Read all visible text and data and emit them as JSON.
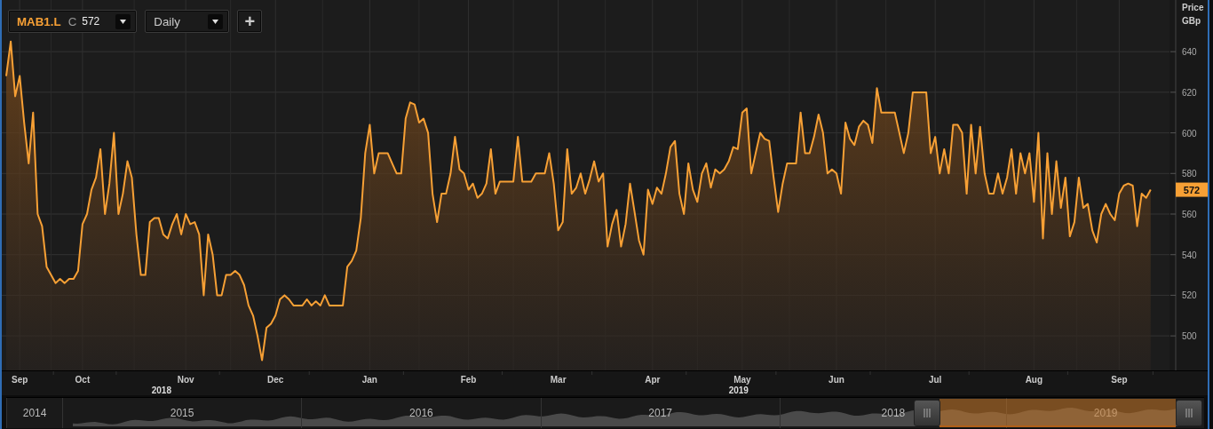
{
  "toolbar": {
    "symbol": "MAB1.L",
    "price_prefix": "C",
    "price": "572",
    "interval": "Daily",
    "add_button": "+"
  },
  "chart": {
    "axis_title": "Price",
    "axis_unit": "GBp",
    "last_price": "572",
    "year_labels": [
      "2018",
      "2019"
    ],
    "chart_data": {
      "type": "area",
      "grid": true,
      "categories": [
        null,
        null,
        null,
        "Sep",
        null,
        null,
        null,
        null,
        null,
        null,
        null,
        null,
        null,
        null,
        null,
        null,
        null,
        "Oct",
        null,
        null,
        null,
        null,
        null,
        null,
        null,
        null,
        null,
        null,
        null,
        null,
        null,
        null,
        null,
        null,
        null,
        null,
        null,
        null,
        null,
        null,
        "Nov",
        null,
        null,
        null,
        null,
        null,
        null,
        null,
        null,
        null,
        null,
        null,
        null,
        null,
        null,
        null,
        null,
        null,
        null,
        null,
        "Dec",
        null,
        null,
        null,
        null,
        null,
        null,
        null,
        null,
        null,
        null,
        null,
        null,
        null,
        null,
        null,
        null,
        null,
        null,
        null,
        null,
        "Jan",
        null,
        null,
        null,
        null,
        null,
        null,
        null,
        null,
        null,
        null,
        null,
        null,
        null,
        null,
        null,
        null,
        null,
        null,
        null,
        null,
        null,
        "Feb",
        null,
        null,
        null,
        null,
        null,
        null,
        null,
        null,
        null,
        null,
        null,
        null,
        null,
        null,
        null,
        null,
        null,
        null,
        null,
        "Mar",
        null,
        null,
        null,
        null,
        null,
        null,
        null,
        null,
        null,
        null,
        null,
        null,
        null,
        null,
        null,
        null,
        null,
        null,
        null,
        null,
        "Apr",
        null,
        null,
        null,
        null,
        null,
        null,
        null,
        null,
        null,
        null,
        null,
        null,
        null,
        null,
        null,
        null,
        null,
        null,
        null,
        "May",
        null,
        null,
        null,
        null,
        null,
        null,
        null,
        null,
        null,
        null,
        null,
        null,
        null,
        null,
        null,
        null,
        null,
        null,
        null,
        null,
        "Jun",
        null,
        null,
        null,
        null,
        null,
        null,
        null,
        null,
        null,
        null,
        null,
        null,
        null,
        null,
        null,
        null,
        null,
        null,
        null,
        null,
        null,
        "Jul",
        null,
        null,
        null,
        null,
        null,
        null,
        null,
        null,
        null,
        null,
        null,
        null,
        null,
        null,
        null,
        null,
        null,
        null,
        null,
        null,
        null,
        "Aug",
        null,
        null,
        null,
        null,
        null,
        null,
        null,
        null,
        null,
        null,
        null,
        null,
        null,
        null,
        null,
        null,
        null,
        null,
        "Sep",
        null,
        null,
        null,
        null,
        null,
        null,
        null
      ],
      "ylim": [
        483,
        665
      ],
      "yticks": [
        500,
        520,
        540,
        560,
        580,
        600,
        620,
        640
      ],
      "series": [
        {
          "color": "#f7a035",
          "values": [
            628,
            645,
            618,
            628,
            605,
            585,
            610,
            560,
            554,
            534,
            530,
            526,
            528,
            526,
            528,
            528,
            532,
            555,
            560,
            572,
            578,
            592,
            560,
            575,
            600,
            560,
            570,
            586,
            578,
            550,
            530,
            530,
            556,
            558,
            558,
            550,
            548,
            555,
            560,
            550,
            560,
            555,
            556,
            550,
            520,
            550,
            540,
            520,
            520,
            530,
            530,
            532,
            530,
            525,
            515,
            510,
            500,
            488,
            504,
            506,
            510,
            518,
            520,
            518,
            515,
            515,
            515,
            518,
            515,
            517,
            515,
            520,
            515,
            515,
            515,
            515,
            534,
            537,
            542,
            558,
            590,
            604,
            580,
            590,
            590,
            590,
            585,
            580,
            580,
            607,
            615,
            614,
            605,
            607,
            600,
            570,
            556,
            570,
            570,
            580,
            598,
            582,
            580,
            572,
            575,
            568,
            570,
            575,
            592,
            570,
            576,
            576,
            576,
            576,
            598,
            576,
            576,
            576,
            580,
            580,
            580,
            590,
            575,
            552,
            556,
            592,
            570,
            573,
            580,
            570,
            577,
            586,
            576,
            580,
            544,
            555,
            562,
            544,
            555,
            575,
            561,
            547,
            540,
            572,
            565,
            573,
            570,
            580,
            593,
            596,
            570,
            560,
            585,
            572,
            566,
            580,
            585,
            573,
            582,
            580,
            582,
            586,
            593,
            592,
            610,
            612,
            580,
            590,
            600,
            597,
            596,
            578,
            561,
            575,
            585,
            585,
            585,
            610,
            590,
            590,
            598,
            609,
            600,
            580,
            582,
            580,
            570,
            605,
            597,
            594,
            603,
            606,
            604,
            595,
            622,
            610,
            610,
            610,
            610,
            600,
            590,
            600,
            620,
            620,
            620,
            620,
            590,
            598,
            580,
            592,
            580,
            604,
            604,
            600,
            570,
            604,
            580,
            603,
            580,
            570,
            570,
            580,
            570,
            578,
            592,
            570,
            590,
            580,
            590,
            566,
            600,
            548,
            590,
            560,
            586,
            563,
            578,
            549,
            556,
            578,
            563,
            565,
            552,
            546,
            560,
            565,
            560,
            557,
            570,
            574,
            575,
            574,
            554,
            570,
            568,
            572
          ]
        }
      ]
    }
  },
  "navigator": {
    "years": [
      "2014",
      "2015",
      "2016",
      "2017",
      "2018",
      "2019"
    ]
  }
}
